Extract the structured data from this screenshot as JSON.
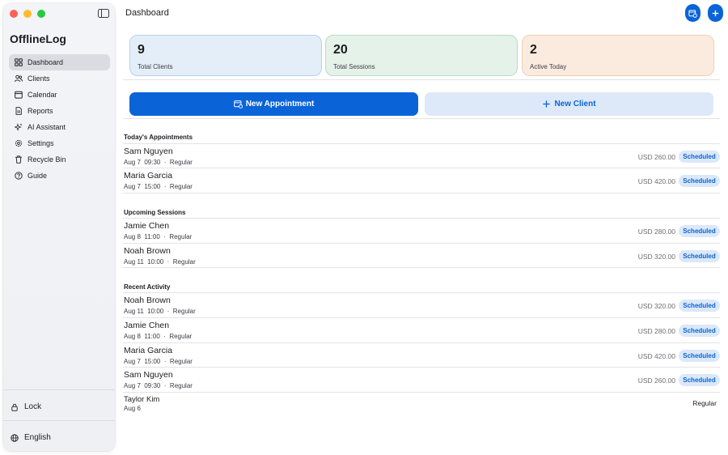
{
  "app": {
    "title": "OfflineLog"
  },
  "sidebar": {
    "items": [
      {
        "label": "Dashboard",
        "icon": "grid-icon",
        "active": true
      },
      {
        "label": "Clients",
        "icon": "people-icon",
        "active": false
      },
      {
        "label": "Calendar",
        "icon": "calendar-icon",
        "active": false
      },
      {
        "label": "Reports",
        "icon": "document-icon",
        "active": false
      },
      {
        "label": "AI Assistant",
        "icon": "sparkle-icon",
        "active": false
      },
      {
        "label": "Settings",
        "icon": "gear-icon",
        "active": false
      },
      {
        "label": "Recycle Bin",
        "icon": "trash-icon",
        "active": false
      },
      {
        "label": "Guide",
        "icon": "question-icon",
        "active": false
      }
    ],
    "lock_label": "Lock",
    "language_label": "English"
  },
  "header": {
    "title": "Dashboard"
  },
  "stats": [
    {
      "value": "9",
      "label": "Total Clients",
      "color": "#e4eef9"
    },
    {
      "value": "20",
      "label": "Total Sessions",
      "color": "#e4f2e9"
    },
    {
      "value": "2",
      "label": "Active Today",
      "color": "#fbebdf"
    }
  ],
  "actions": {
    "new_appointment": "New Appointment",
    "new_client": "New Client"
  },
  "sections": {
    "today": {
      "title": "Today's Appointments",
      "rows": [
        {
          "name": "Sam Nguyen",
          "meta": "Aug 7  09:30  ·  Regular",
          "amount": "USD 260.00",
          "status": "Scheduled"
        },
        {
          "name": "Maria Garcia",
          "meta": "Aug 7  15:00  ·  Regular",
          "amount": "USD 420.00",
          "status": "Scheduled"
        }
      ]
    },
    "upcoming": {
      "title": "Upcoming Sessions",
      "rows": [
        {
          "name": "Jamie Chen",
          "meta": "Aug 8  11:00  ·  Regular",
          "amount": "USD 280.00",
          "status": "Scheduled"
        },
        {
          "name": "Noah Brown",
          "meta": "Aug 11  10:00  ·  Regular",
          "amount": "USD 320.00",
          "status": "Scheduled"
        }
      ]
    },
    "recent": {
      "title": "Recent Activity",
      "rows": [
        {
          "name": "Noah Brown",
          "meta": "Aug 11  10:00  ·  Regular",
          "amount": "USD 320.00",
          "status": "Scheduled"
        },
        {
          "name": "Jamie Chen",
          "meta": "Aug 8  11:00  ·  Regular",
          "amount": "USD 280.00",
          "status": "Scheduled"
        },
        {
          "name": "Maria Garcia",
          "meta": "Aug 7  15:00  ·  Regular",
          "amount": "USD 420.00",
          "status": "Scheduled"
        },
        {
          "name": "Sam Nguyen",
          "meta": "Aug 7  09:30  ·  Regular",
          "amount": "USD 260.00",
          "status": "Scheduled"
        },
        {
          "name": "Taylor Kim",
          "meta": "Aug 6",
          "amount": "",
          "status": "Regular"
        }
      ]
    }
  },
  "colors": {
    "accent": "#0a64d8",
    "badge_bg": "#dbe8f8"
  }
}
